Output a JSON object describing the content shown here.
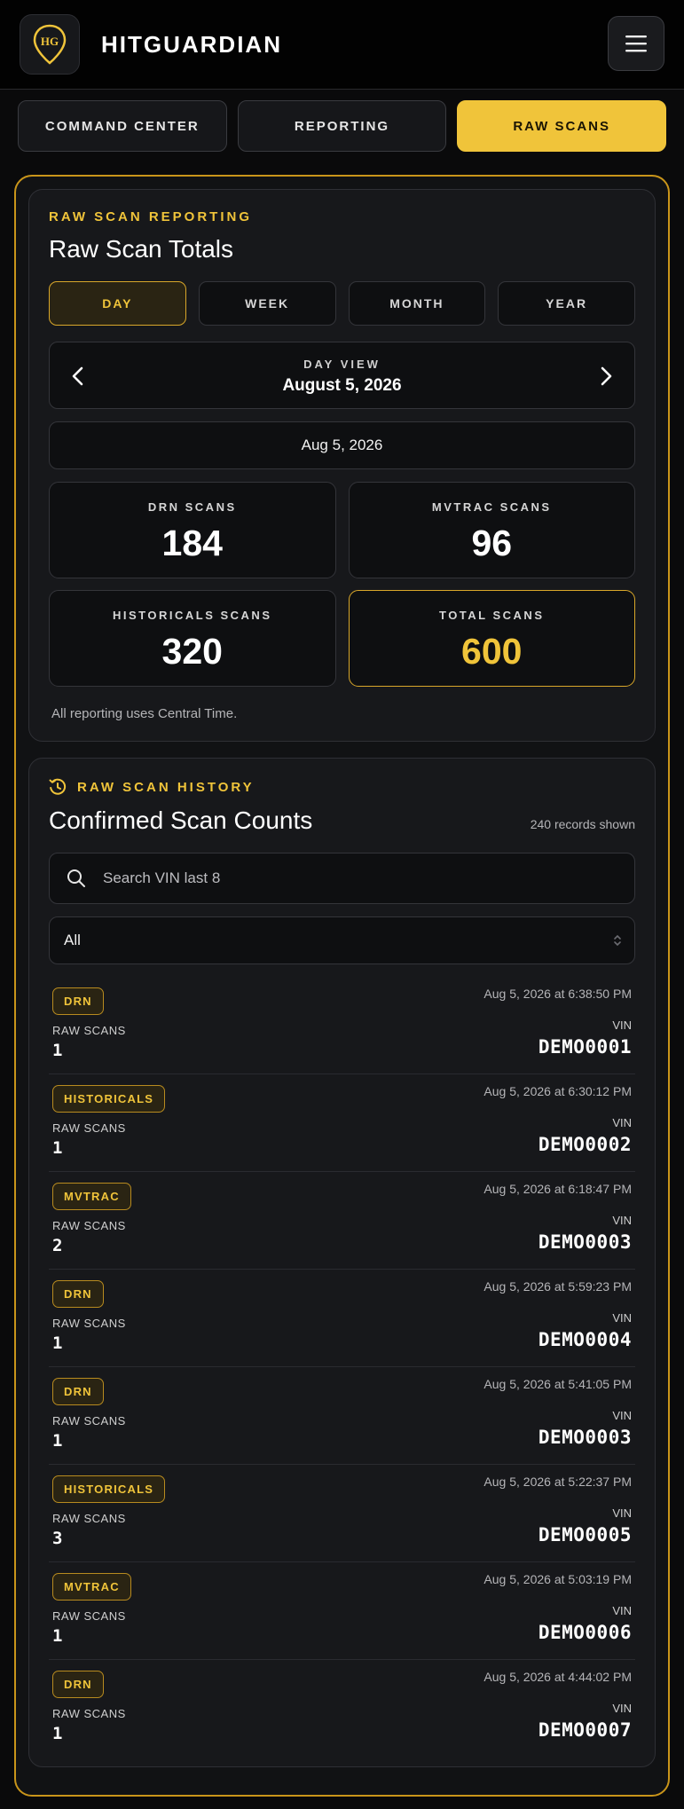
{
  "app": {
    "brand": "HITGUARDIAN",
    "logo_text": "HG"
  },
  "tabs": [
    {
      "label": "COMMAND CENTER",
      "active": false
    },
    {
      "label": "REPORTING",
      "active": false
    },
    {
      "label": "RAW SCANS",
      "active": true
    }
  ],
  "totals": {
    "eyebrow": "RAW SCAN REPORTING",
    "title": "Raw Scan Totals",
    "periods": [
      "DAY",
      "WEEK",
      "MONTH",
      "YEAR"
    ],
    "active_period": "DAY",
    "view_label": "DAY VIEW",
    "view_date": "August 5, 2026",
    "date_field": "Aug 5, 2026",
    "stats": [
      {
        "label": "DRN SCANS",
        "value": "184"
      },
      {
        "label": "MVTRAC SCANS",
        "value": "96"
      },
      {
        "label": "HISTORICALS SCANS",
        "value": "320"
      },
      {
        "label": "TOTAL SCANS",
        "value": "600"
      }
    ],
    "note": "All reporting uses Central Time."
  },
  "history": {
    "eyebrow": "RAW SCAN HISTORY",
    "title": "Confirmed Scan Counts",
    "records": "240 records shown",
    "search_placeholder": "Search VIN last 8",
    "filter_value": "All",
    "raw_scans_label": "RAW SCANS",
    "vin_label": "VIN",
    "rows": [
      {
        "type": "DRN",
        "timestamp": "Aug 5, 2026 at 6:38:50 PM",
        "raw_scans": "1",
        "vin": "DEMO0001"
      },
      {
        "type": "HISTORICALS",
        "timestamp": "Aug 5, 2026 at 6:30:12 PM",
        "raw_scans": "1",
        "vin": "DEMO0002"
      },
      {
        "type": "MVTRAC",
        "timestamp": "Aug 5, 2026 at 6:18:47 PM",
        "raw_scans": "2",
        "vin": "DEMO0003"
      },
      {
        "type": "DRN",
        "timestamp": "Aug 5, 2026 at 5:59:23 PM",
        "raw_scans": "1",
        "vin": "DEMO0004"
      },
      {
        "type": "DRN",
        "timestamp": "Aug 5, 2026 at 5:41:05 PM",
        "raw_scans": "1",
        "vin": "DEMO0003"
      },
      {
        "type": "HISTORICALS",
        "timestamp": "Aug 5, 2026 at 5:22:37 PM",
        "raw_scans": "3",
        "vin": "DEMO0005"
      },
      {
        "type": "MVTRAC",
        "timestamp": "Aug 5, 2026 at 5:03:19 PM",
        "raw_scans": "1",
        "vin": "DEMO0006"
      },
      {
        "type": "DRN",
        "timestamp": "Aug 5, 2026 at 4:44:02 PM",
        "raw_scans": "1",
        "vin": "DEMO0007"
      }
    ]
  },
  "colors": {
    "accent": "#f0c43a",
    "background": "#0a0a0b",
    "card": "#17181b"
  }
}
